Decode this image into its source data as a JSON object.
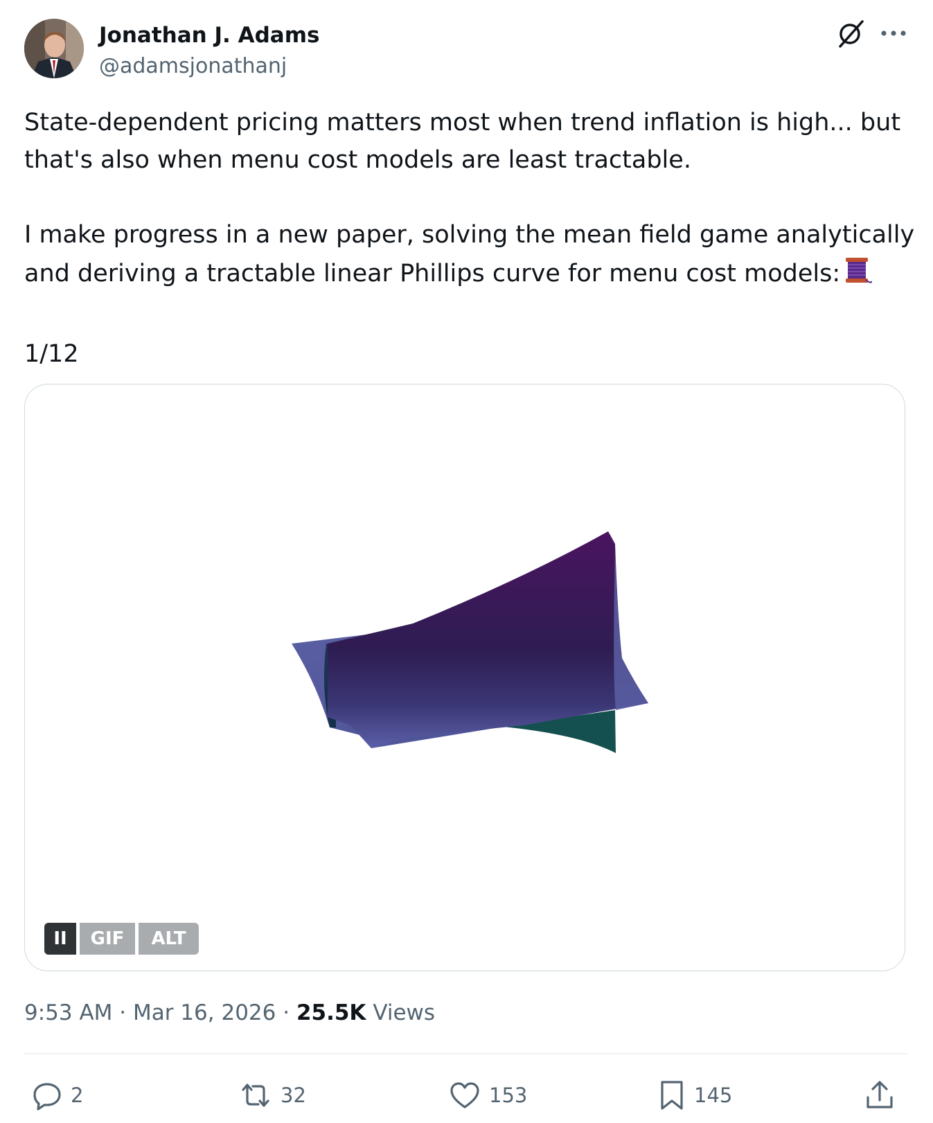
{
  "author": {
    "name": "Jonathan J. Adams",
    "handle": "@adamsjonathanj"
  },
  "header_icons": [
    "grok-icon",
    "more-icon"
  ],
  "tweet": {
    "line1": "State-dependent pricing matters most when trend inflation is high... but",
    "line2": "that's also when menu cost models are least tractable.",
    "line3": "I make progress in a new paper, solving the mean field game analytically",
    "line4": "and deriving a tractable linear Phillips curve for menu cost models:",
    "emoji": "🧵",
    "thread_counter": "1/12"
  },
  "media": {
    "type": "gif",
    "pause_label": "II",
    "gif_label": "GIF",
    "alt_label": "ALT",
    "colors": {
      "back_surface": "#5a5fa3",
      "front_top": "#4a1460",
      "front_mid": "#2e1d52",
      "front_bottom": "#5b5fa8",
      "teal": "#14504f"
    }
  },
  "meta": {
    "time": "9:53 AM",
    "separator": " · ",
    "date": "Mar 16, 2026",
    "views_count": "25.5K",
    "views_label": "Views"
  },
  "actions": {
    "replies": "2",
    "reposts": "32",
    "likes": "153",
    "bookmarks": "145"
  },
  "colors": {
    "text_primary": "#0f1419",
    "text_secondary": "#536471",
    "border": "#cfd9de"
  }
}
